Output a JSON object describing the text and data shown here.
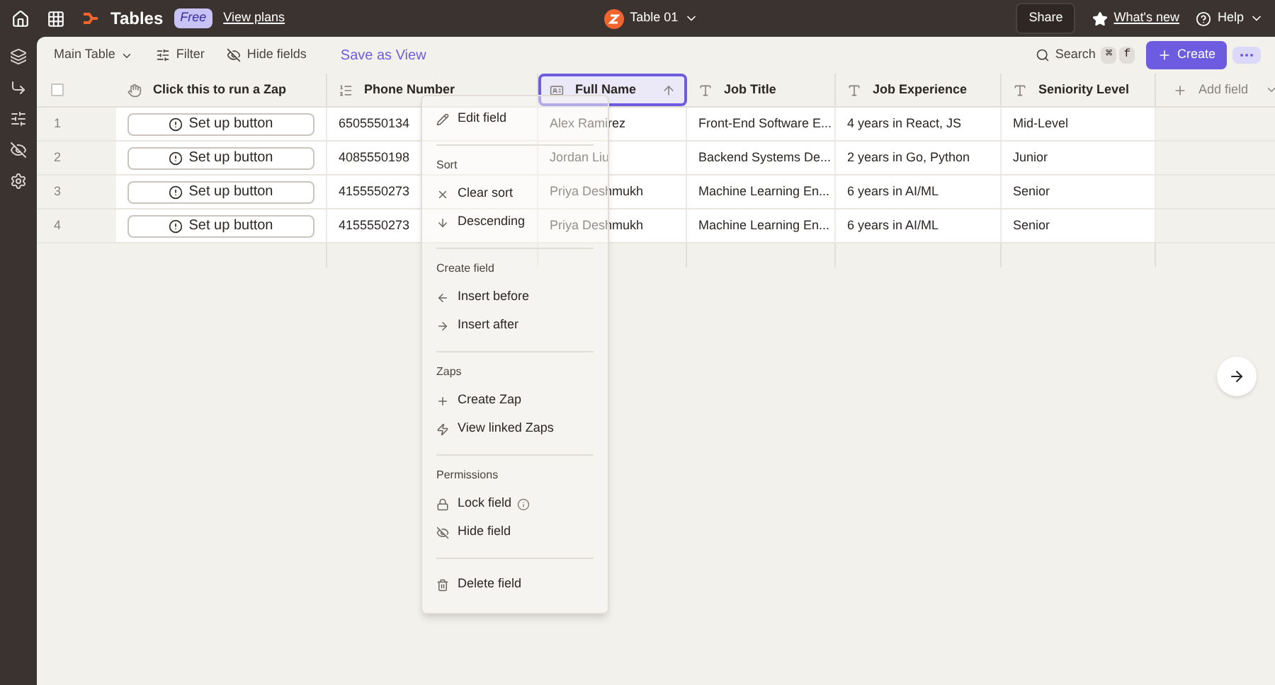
{
  "topbar": {
    "app_name": "Tables",
    "plan_badge": "Free",
    "view_plans": "View plans",
    "table_name": "Table 01",
    "share": "Share",
    "whats_new": "What's new",
    "help": "Help"
  },
  "toolbar": {
    "view": "Main Table",
    "filter": "Filter",
    "hide_fields": "Hide fields",
    "save_view": "Save as View",
    "search": "Search",
    "shortcut": [
      "⌘",
      "f"
    ],
    "create": "Create"
  },
  "table": {
    "columns": [
      {
        "label": "Click this to run a Zap",
        "kind": "button",
        "selected": false
      },
      {
        "label": "Phone Number",
        "kind": "number",
        "selected": false
      },
      {
        "label": "Full Name",
        "kind": "name",
        "selected": true,
        "sorted_ascending": true
      },
      {
        "label": "Job Title",
        "kind": "text",
        "selected": false
      },
      {
        "label": "Job Experience",
        "kind": "text",
        "selected": false
      },
      {
        "label": "Seniority Level",
        "kind": "text",
        "selected": false
      }
    ],
    "add_field": "Add field",
    "select_all_checked": false,
    "rows": [
      {
        "number": "1",
        "cells": [
          "Set up button",
          "6505550134",
          "Alex Ramirez",
          "Front-End Software E...",
          "4 years in React, JS",
          "Mid-Level"
        ]
      },
      {
        "number": "2",
        "cells": [
          "Set up button",
          "4085550198",
          "Jordan Liu",
          "Backend Systems De...",
          "2 years in Go, Python",
          "Junior"
        ]
      },
      {
        "number": "3",
        "cells": [
          "Set up button",
          "4155550273",
          "Priya Deshmukh",
          "Machine Learning En...",
          "6 years in AI/ML",
          "Senior"
        ]
      },
      {
        "number": "4",
        "cells": [
          "Set up button",
          "4155550273",
          "Priya Deshmukh",
          "Machine Learning En...",
          "6 years in AI/ML",
          "Senior"
        ]
      }
    ]
  },
  "menu": {
    "sections": [
      {
        "items": [
          {
            "label": "Edit field"
          }
        ]
      },
      {
        "heading": "Sort",
        "items": [
          {
            "label": "Clear sort"
          },
          {
            "label": "Descending"
          }
        ]
      },
      {
        "heading": "Create field",
        "items": [
          {
            "label": "Insert before"
          },
          {
            "label": "Insert after"
          }
        ]
      },
      {
        "heading": "Zaps",
        "items": [
          {
            "label": "Create Zap"
          },
          {
            "label": "View linked Zaps"
          }
        ]
      },
      {
        "heading": "Permissions",
        "items": [
          {
            "label": "Lock field",
            "info": true
          },
          {
            "label": "Hide field",
            "info": false
          }
        ]
      },
      {
        "items": [
          {
            "label": "Delete field"
          }
        ]
      }
    ]
  }
}
